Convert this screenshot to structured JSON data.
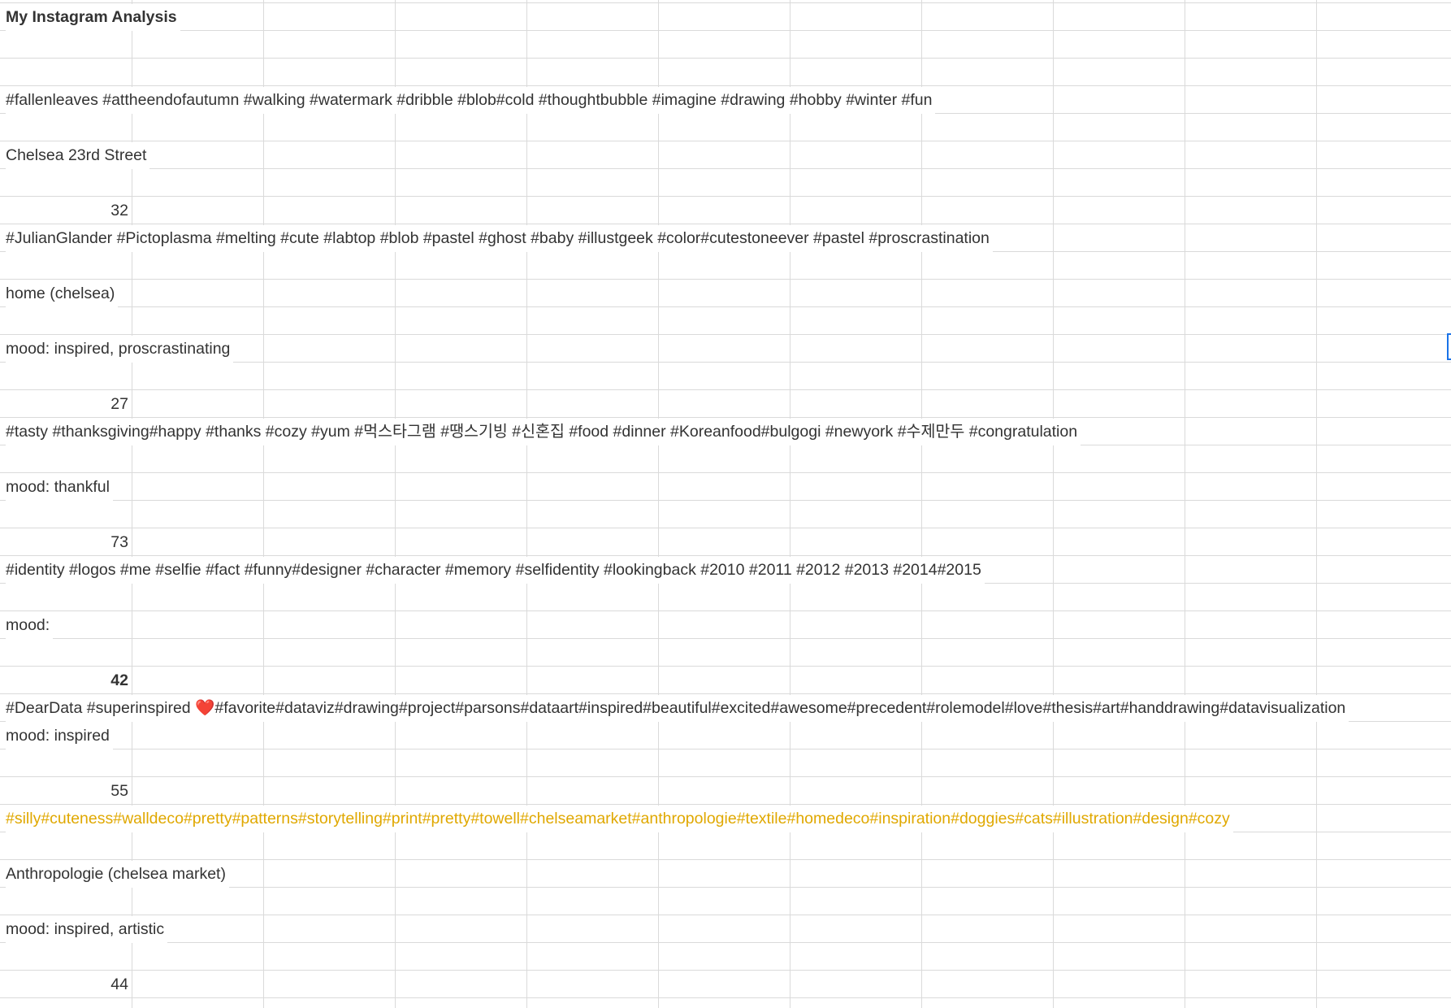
{
  "title": "My Instagram Analysis",
  "accent_colors": {
    "highlight_text": "#e0a800",
    "selection": "#1a73e8",
    "heart": "#d32f2f"
  },
  "rows": {
    "r4": "#fallenleaves #attheendofautumn #walking #watermark #dribble #blob#cold #thoughtbubble #imagine #drawing #hobby #winter #fun",
    "r6": "Chelsea 23rd Street",
    "r8": "32",
    "r9": "#JulianGlander #Pictoplasma #melting #cute #labtop #blob #pastel #ghost #baby #illustgeek #color#cutestoneever #pastel #proscrastination",
    "r11": "home (chelsea)",
    "r13": "mood: inspired, proscrastinating",
    "r15": "27",
    "r16": "#tasty #thanksgiving#happy #thanks #cozy #yum #먹스타그램 #땡스기빙 #신혼집 #food #dinner #Koreanfood#bulgogi #newyork #수제만두 #congratulation",
    "r18": "mood: thankful",
    "r20": "73",
    "r21": "#identity #logos #me #selfie #fact #funny#designer #character #memory #selfidentity #lookingback #2010 #2011 #2012 #2013 #2014#2015",
    "r23": "mood:",
    "r25": "42",
    "r26_before_heart": "#DearData #superinspired ",
    "r26_heart": "❤️",
    "r26_after_heart": "#favorite#dataviz#drawing#project#parsons#dataart#inspired#beautiful#excited#awesome#precedent#rolemodel#love#thesis#art#handdrawing#datavisualization",
    "r27": "mood: inspired",
    "r29": "55",
    "r30": "#silly#cuteness#walldeco#pretty#patterns#storytelling#print#pretty#towell#chelseamarket#anthropologie#textile#homedeco#inspiration#doggies#cats#illustration#design#cozy",
    "r32": "Anthropologie (chelsea market)",
    "r34": "mood: inspired, artistic",
    "r36": "44"
  }
}
